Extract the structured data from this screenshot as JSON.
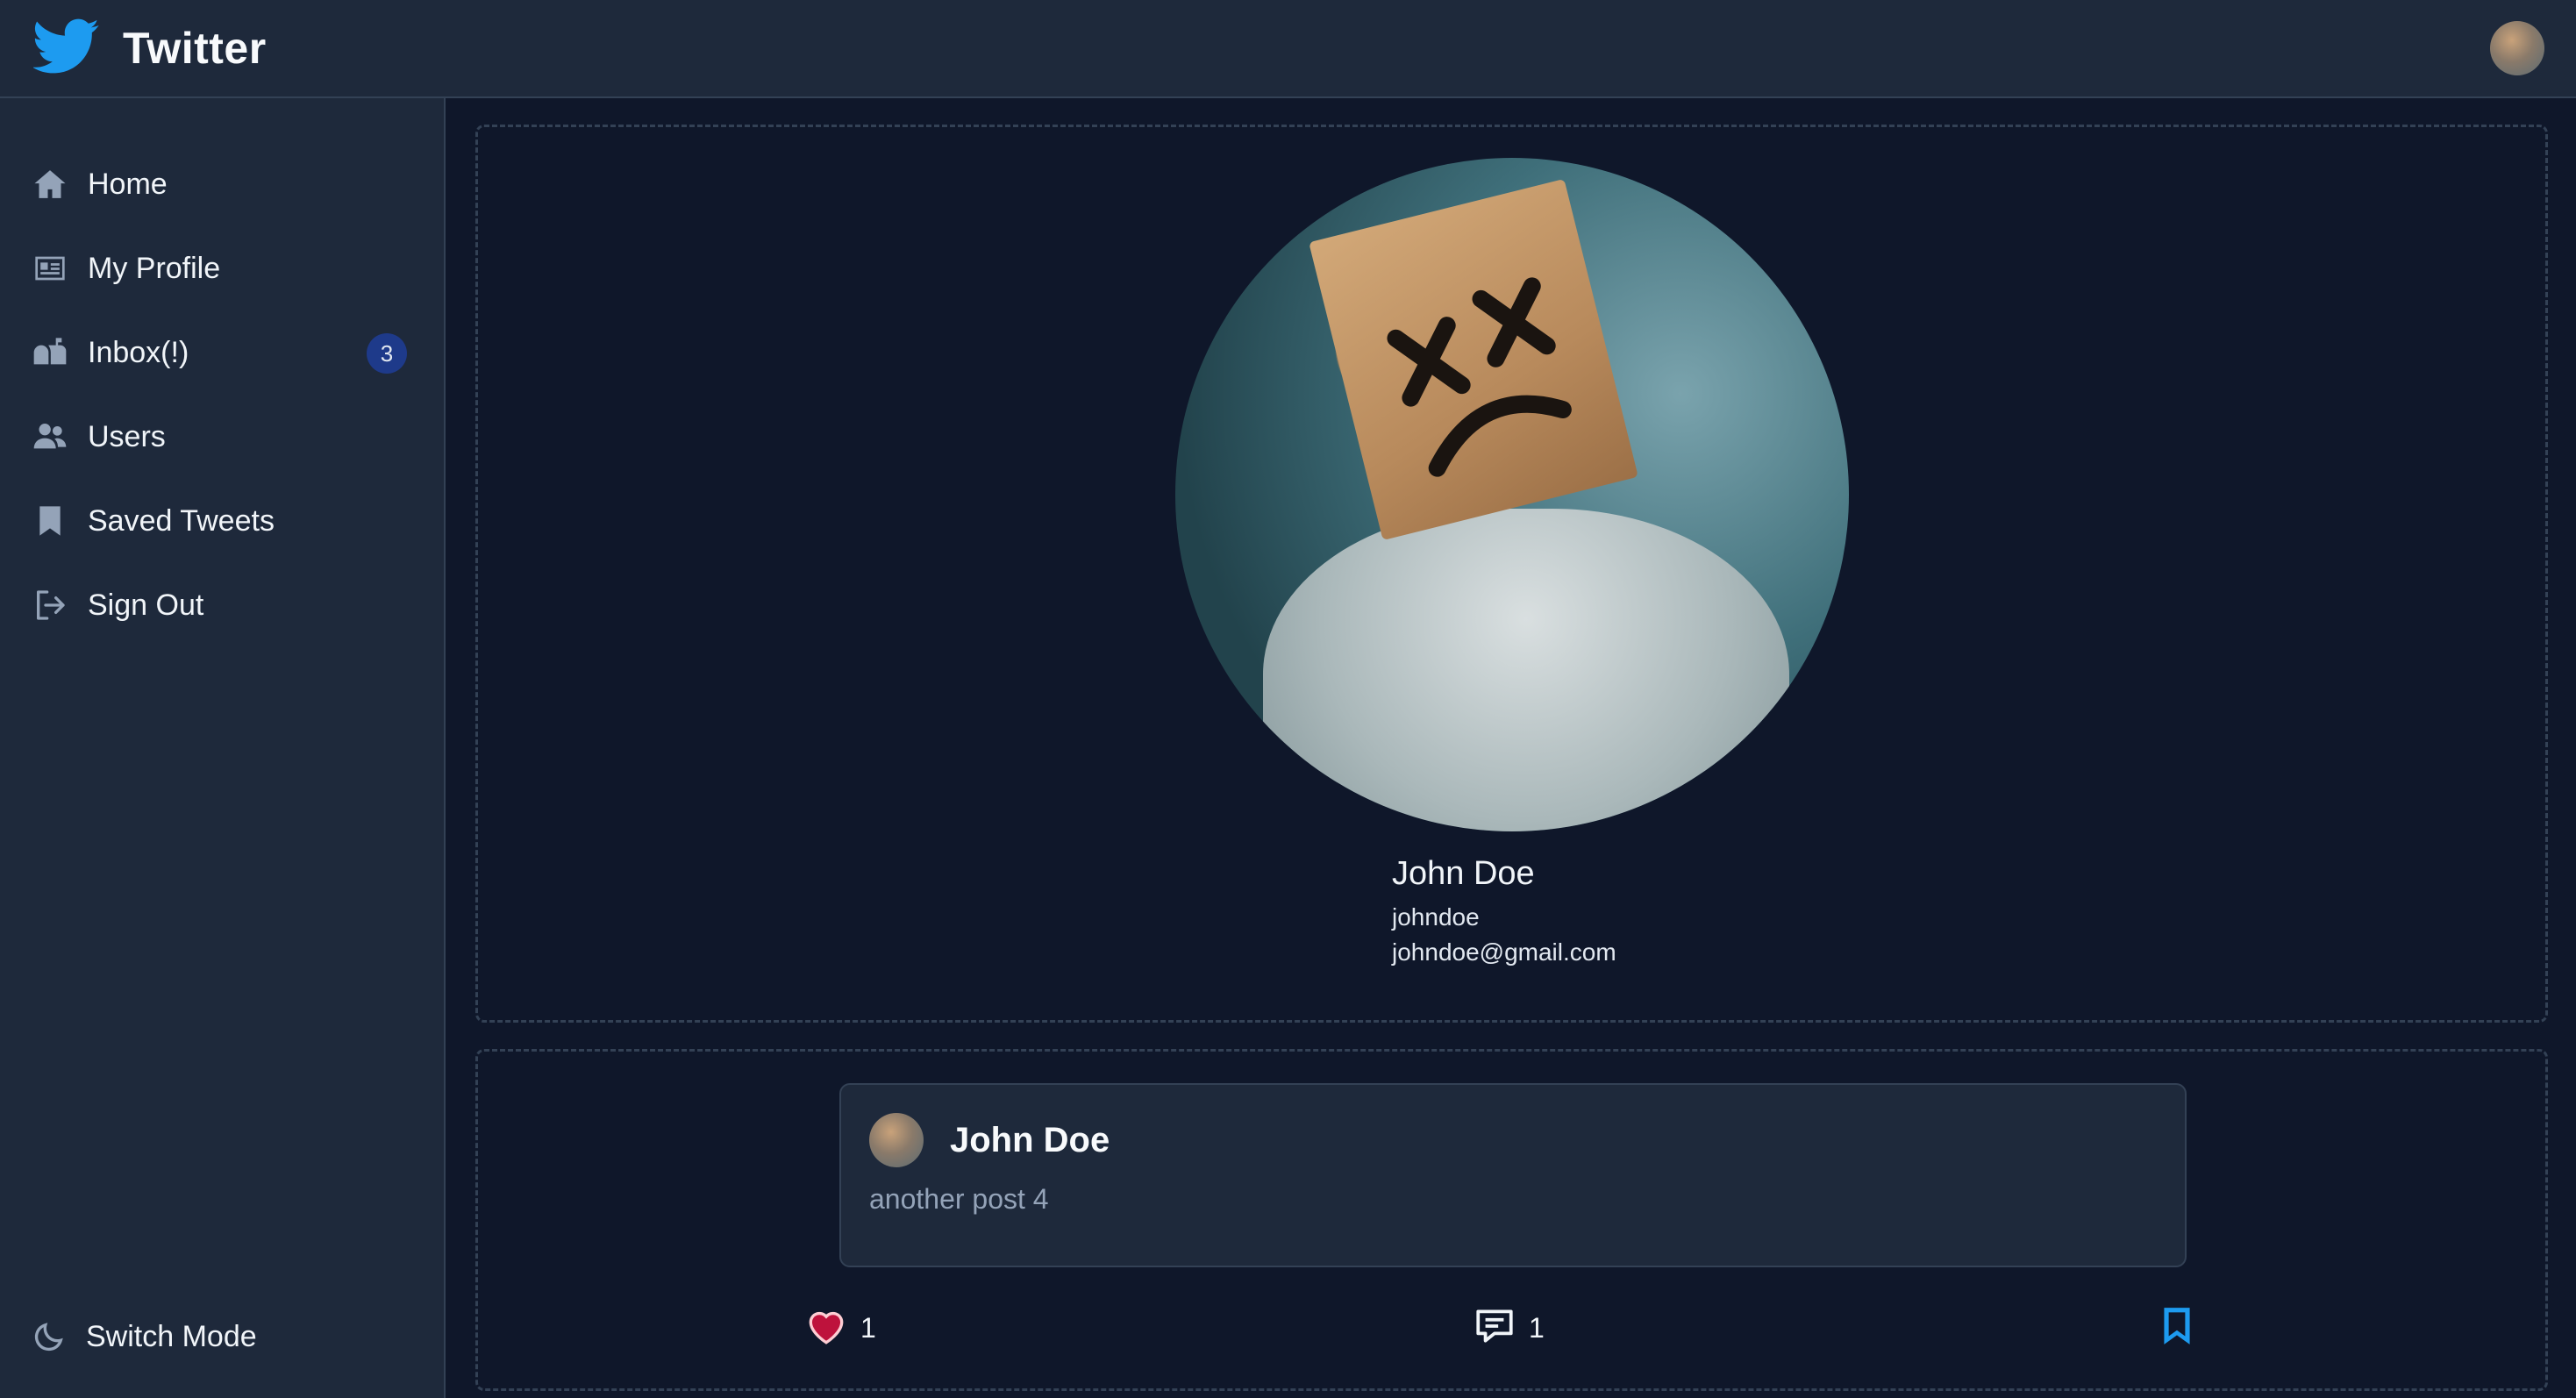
{
  "header": {
    "title": "Twitter",
    "brand_color": "#1d9bf0"
  },
  "sidebar": {
    "items": [
      {
        "label": "Home",
        "icon": "home-icon"
      },
      {
        "label": "My Profile",
        "icon": "id-card-icon"
      },
      {
        "label": "Inbox(!)",
        "icon": "mailbox-icon",
        "badge": "3"
      },
      {
        "label": "Users",
        "icon": "users-icon"
      },
      {
        "label": "Saved Tweets",
        "icon": "bookmark-icon"
      },
      {
        "label": "Sign Out",
        "icon": "sign-out-icon"
      }
    ],
    "switch_mode": {
      "label": "Switch Mode",
      "icon": "moon-icon"
    }
  },
  "profile": {
    "name": "John Doe",
    "username": "johndoe",
    "email": "johndoe@gmail.com"
  },
  "tweets": [
    {
      "author": "John Doe",
      "text": "another post 4",
      "likes": "1",
      "comments": "1",
      "liked_color": "#be123c",
      "bookmark_color": "#1d9bf0"
    }
  ]
}
